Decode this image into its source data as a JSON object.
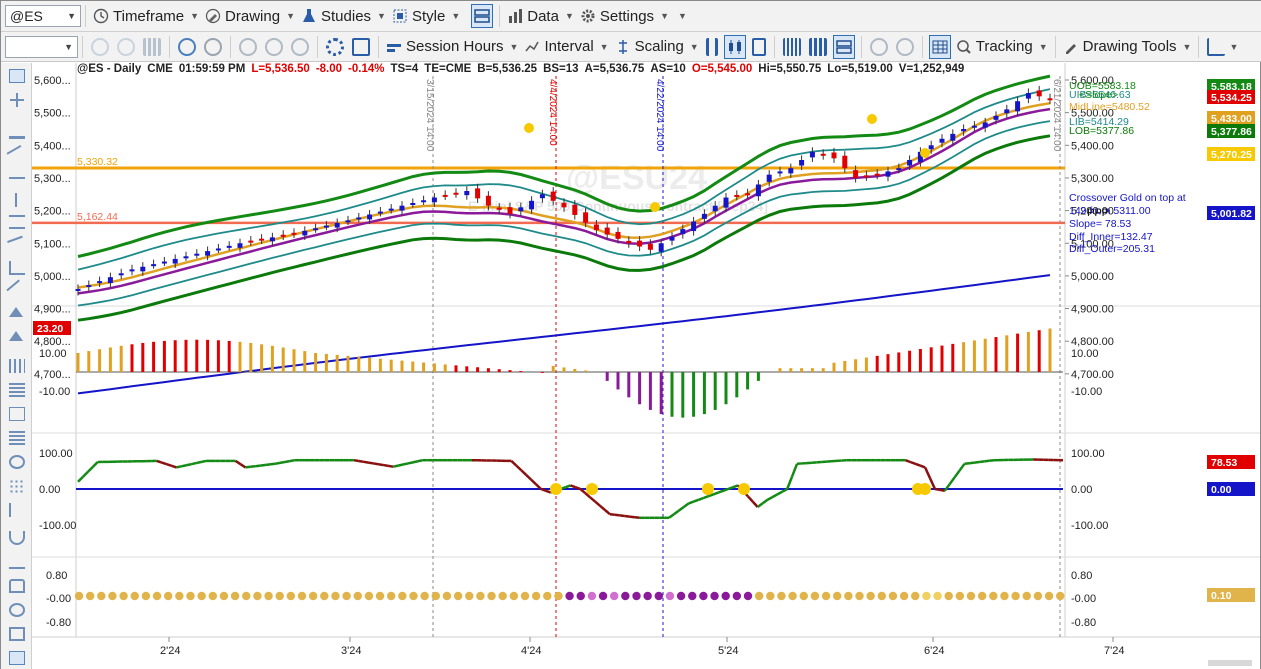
{
  "toolbar1": {
    "symbol": "@ES",
    "timeframe": "Timeframe",
    "drawing": "Drawing",
    "studies": "Studies",
    "style": "Style",
    "data": "Data",
    "settings": "Settings"
  },
  "toolbar2": {
    "session_hours": "Session Hours",
    "interval": "Interval",
    "scaling": "Scaling",
    "tracking": "Tracking",
    "drawing_tools": "Drawing Tools"
  },
  "info": {
    "symbol": "@ES - Daily",
    "exchange": "CME",
    "time": "01:59:59 PM",
    "last": "L=5,536.50",
    "change": "-8.00",
    "pct": "-0.14%",
    "ts": "TS=4",
    "te": "TE=CME",
    "bid": "B=5,536.25",
    "bs": "BS=13",
    "ask": "A=5,536.75",
    "as": "AS=10",
    "open": "O=5,545.00",
    "hi": "Hi=5,550.75",
    "lo": "Lo=5,519.00",
    "vol": "V=1,252,949"
  },
  "watermark": {
    "line1": "@ESU24",
    "line2": "E-mini S&P 500 Continuous Contract [Sep24]"
  },
  "price_axis": [
    "5,600.00",
    "5,500.00",
    "5,400.00",
    "5,300.00",
    "5,200.00",
    "5,100.00",
    "5,000.00",
    "4,900.00",
    "4,800.00",
    "4,700.00"
  ],
  "left_axis": [
    "5,600...",
    "5,500...",
    "5,400...",
    "5,300...",
    "5,200...",
    "5,100...",
    "5,000...",
    "4,900...",
    "4,800...",
    "4,700..."
  ],
  "hlines": [
    {
      "label": "5,330.32",
      "color": "#f0a30a"
    },
    {
      "label": "5,162.44",
      "color": "#f26a4f"
    }
  ],
  "badges": {
    "uob": "5,583.18",
    "last": "5,534.25",
    "lib": "5,433.00",
    "lob": "5,377.86",
    "gold": "5,270.25",
    "blue": "5,001.82",
    "hist": "23.20",
    "osc": "78.53",
    "zero": "0.00",
    "dots": "0.10"
  },
  "legend": {
    "uob": "UOB=5583.18",
    "uib": "UIB=5546.63",
    "slope": "<Slope>",
    "midline": "MidLine=5480.52",
    "lib": "LIB=5414.29",
    "lob": "LOB=5377.86"
  },
  "notes": {
    "crossover": "Crossover Gold on top at",
    "price": "149 from 5311.00",
    "ppp": "PPP",
    "slope": "Slope= 78.53",
    "inner": "Diff_Inner=132.47",
    "outer": "Diff_Outer=205.31"
  },
  "vlines": [
    {
      "label": "3/15/2024 14:00",
      "color": "#888888"
    },
    {
      "label": "4/4/2024 14:00",
      "color": "#e00000"
    },
    {
      "label": "4/22/2024 14:00",
      "color": "#1a1acc"
    },
    {
      "label": "6/21/2024 14:00",
      "color": "#888888"
    }
  ],
  "hist_axis": [
    "10.00",
    "-10.00"
  ],
  "osc_axis": [
    "100.00",
    "0.00",
    "-100.00"
  ],
  "dot_axis": [
    "0.80",
    "-0.00",
    "-0.80"
  ],
  "x_axis": [
    "2'24",
    "3'24",
    "4'24",
    "5'24",
    "6'24",
    "7'24"
  ],
  "colors": {
    "uob": "#138a13",
    "lib": "#1f8a8a",
    "midline": "#e0a020",
    "purple": "#8a1a9a",
    "lob_line": "#0b7a0b",
    "blue_line": "#1414c8",
    "last_badge": "#e00000"
  }
}
